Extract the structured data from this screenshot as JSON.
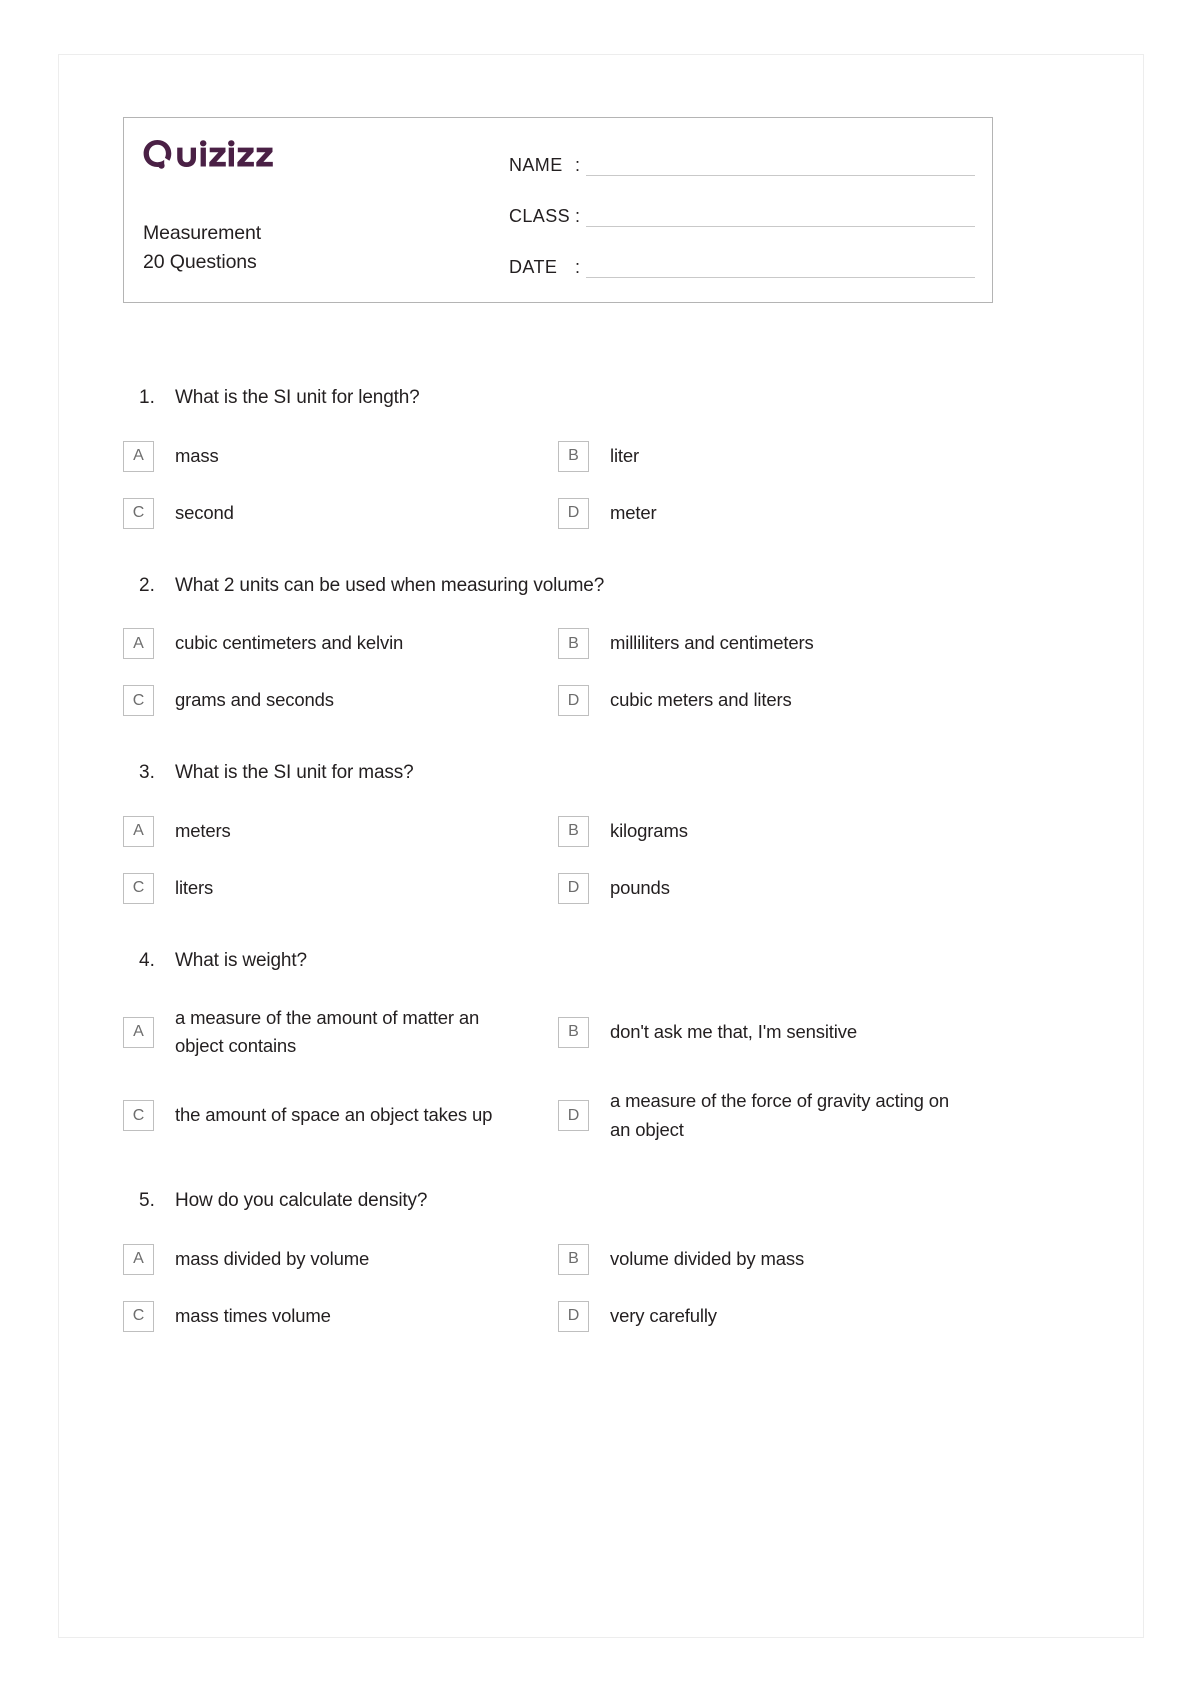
{
  "page": {
    "brand_color": "#4a2045",
    "logo_text": "Quizizz"
  },
  "header": {
    "quiz_title": "Measurement",
    "question_count_label": "20 Questions",
    "fields": [
      {
        "label": "NAME",
        "colon": ":",
        "value": ""
      },
      {
        "label": "CLASS",
        "colon": ":",
        "value": ""
      },
      {
        "label": "DATE",
        "colon": ":",
        "value": ""
      }
    ]
  },
  "questions": [
    {
      "number": "1.",
      "text": "What is the SI unit for length?",
      "options": [
        {
          "letter": "A",
          "text": "mass"
        },
        {
          "letter": "B",
          "text": "liter"
        },
        {
          "letter": "C",
          "text": "second"
        },
        {
          "letter": "D",
          "text": "meter"
        }
      ]
    },
    {
      "number": "2.",
      "text": "What 2 units can be used when measuring volume?",
      "options": [
        {
          "letter": "A",
          "text": "cubic centimeters and kelvin"
        },
        {
          "letter": "B",
          "text": "milliliters and centimeters"
        },
        {
          "letter": "C",
          "text": "grams and seconds"
        },
        {
          "letter": "D",
          "text": "cubic meters and liters"
        }
      ]
    },
    {
      "number": "3.",
      "text": "What is the SI unit for mass?",
      "options": [
        {
          "letter": "A",
          "text": "meters"
        },
        {
          "letter": "B",
          "text": "kilograms"
        },
        {
          "letter": "C",
          "text": "liters"
        },
        {
          "letter": "D",
          "text": "pounds"
        }
      ]
    },
    {
      "number": "4.",
      "text": "What is weight?",
      "options": [
        {
          "letter": "A",
          "text": "a measure of the amount of matter an object contains"
        },
        {
          "letter": "B",
          "text": "don't ask me that, I'm sensitive"
        },
        {
          "letter": "C",
          "text": "the amount of space an object takes up"
        },
        {
          "letter": "D",
          "text": "a measure of the force of gravity acting on an object"
        }
      ]
    },
    {
      "number": "5.",
      "text": "How do you calculate density?",
      "options": [
        {
          "letter": "A",
          "text": "mass divided by volume"
        },
        {
          "letter": "B",
          "text": "volume divided by mass"
        },
        {
          "letter": "C",
          "text": "mass times volume"
        },
        {
          "letter": "D",
          "text": "very carefully"
        }
      ]
    }
  ]
}
